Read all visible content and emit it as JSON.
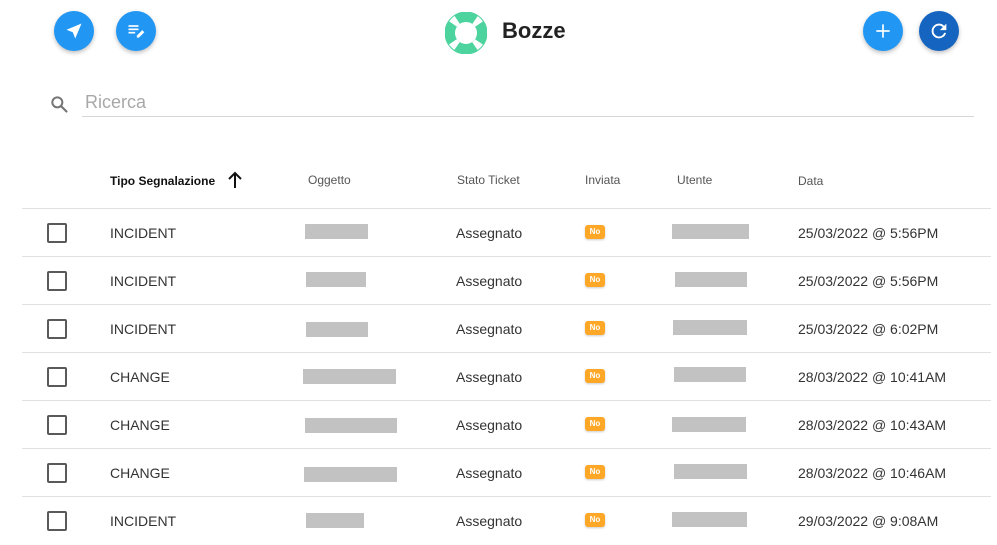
{
  "header": {
    "title": "Bozze",
    "buttons": {
      "send_icon": "send-icon",
      "edit_icon": "edit-note-icon",
      "add_icon": "add-icon",
      "refresh_icon": "refresh-icon"
    },
    "logo_icon": "lifebuoy-icon",
    "colors": {
      "primary": "#2196f3",
      "primary_dark": "#1565c0",
      "logo": "#4cd39e",
      "badge": "#ffa726"
    }
  },
  "search": {
    "placeholder": "Ricerca",
    "value": ""
  },
  "table": {
    "columns": [
      "Tipo Segnalazione",
      "Oggetto",
      "Stato Ticket",
      "Inviata",
      "Utente",
      "Data"
    ],
    "sort": {
      "column": "Tipo Segnalazione",
      "direction": "ascending"
    },
    "rows": [
      {
        "tipo": "INCIDENT",
        "oggetto": "[redacted]",
        "stato": "Assegnato",
        "inviata": "No",
        "utente": "[redacted]",
        "data": "25/03/2022 @ 5:56PM"
      },
      {
        "tipo": "INCIDENT",
        "oggetto": "[redacted]",
        "stato": "Assegnato",
        "inviata": "No",
        "utente": "[redacted]",
        "data": "25/03/2022 @ 5:56PM"
      },
      {
        "tipo": "INCIDENT",
        "oggetto": "[redacted]",
        "stato": "Assegnato",
        "inviata": "No",
        "utente": "[redacted]",
        "data": "25/03/2022 @ 6:02PM"
      },
      {
        "tipo": "CHANGE",
        "oggetto": "[redacted]",
        "stato": "Assegnato",
        "inviata": "No",
        "utente": "[redacted]",
        "data": "28/03/2022 @ 10:41AM"
      },
      {
        "tipo": "CHANGE",
        "oggetto": "[redacted]",
        "stato": "Assegnato",
        "inviata": "No",
        "utente": "[redacted]",
        "data": "28/03/2022 @ 10:43AM"
      },
      {
        "tipo": "CHANGE",
        "oggetto": "[redacted]",
        "stato": "Assegnato",
        "inviata": "No",
        "utente": "[redacted]",
        "data": "28/03/2022 @ 10:46AM"
      },
      {
        "tipo": "INCIDENT",
        "oggetto": "[redacted]",
        "stato": "Assegnato",
        "inviata": "No",
        "utente": "[redacted]",
        "data": "29/03/2022 @ 9:08AM"
      }
    ]
  }
}
